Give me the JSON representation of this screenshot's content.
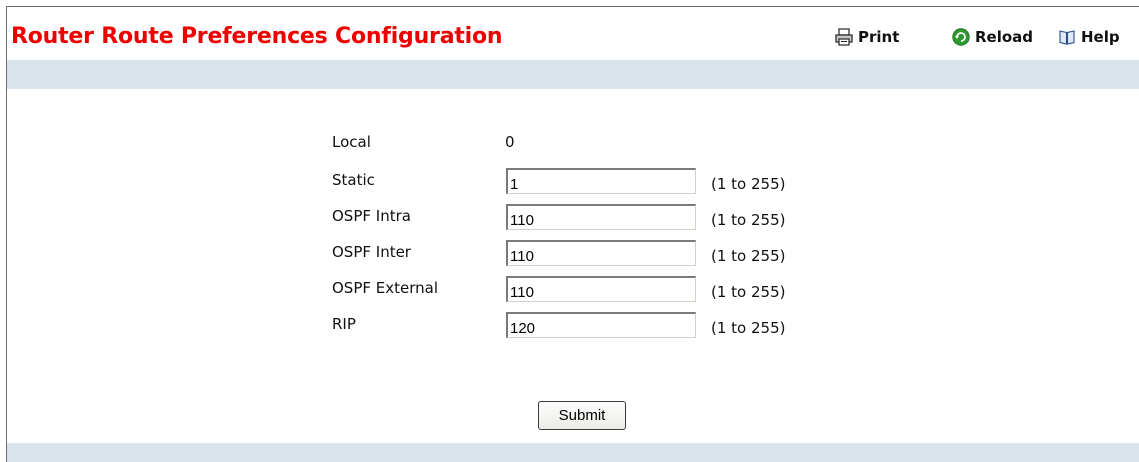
{
  "header": {
    "title": "Router Route Preferences Configuration",
    "actions": [
      {
        "label": "Print",
        "icon": "printer-icon"
      },
      {
        "label": "Reload",
        "icon": "reload-icon"
      },
      {
        "label": "Help",
        "icon": "help-book-icon"
      }
    ]
  },
  "form": {
    "local": {
      "label": "Local",
      "value": "0"
    },
    "fields": [
      {
        "label": "Static",
        "value": "1",
        "range": "(1 to 255)"
      },
      {
        "label": "OSPF Intra",
        "value": "110",
        "range": "(1 to 255)"
      },
      {
        "label": "OSPF Inter",
        "value": "110",
        "range": "(1 to 255)"
      },
      {
        "label": "OSPF External",
        "value": "110",
        "range": "(1 to 255)"
      },
      {
        "label": "RIP",
        "value": "120",
        "range": "(1 to 255)"
      }
    ],
    "submit_label": "Submit"
  },
  "colors": {
    "title": "#ee0000",
    "band": "#d8e3ec",
    "reload_icon": "#2e9a2e"
  }
}
